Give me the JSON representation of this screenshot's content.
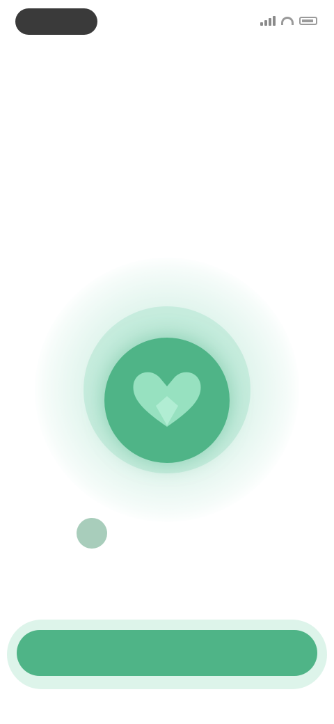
{
  "status_bar": {
    "note": "",
    "time": ""
  },
  "header": {
    "title": "",
    "title_accent": "",
    "subtitle": ""
  },
  "center": {
    "icon": "shield-heart-icon"
  },
  "hint": {
    "text": "",
    "secondary_text": ""
  },
  "cta": {
    "label": ""
  },
  "colors": {
    "accent": "#4fb487",
    "accent_light": "#5fcba0",
    "glow": "#9bd8bd"
  }
}
